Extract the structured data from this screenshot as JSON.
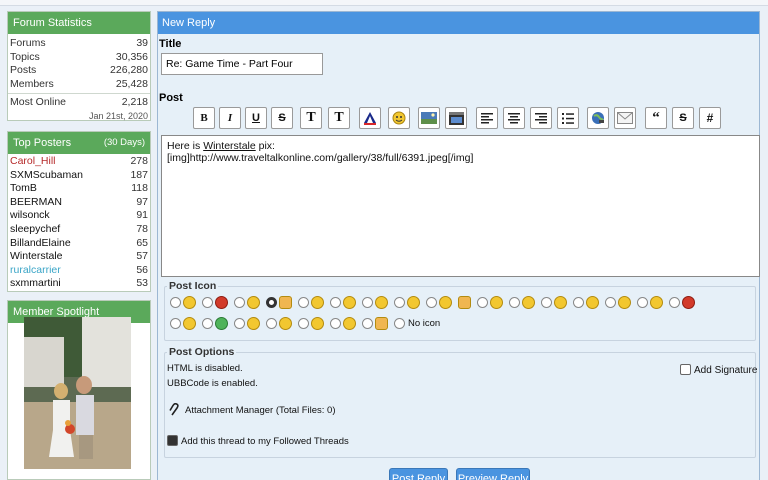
{
  "forum_stats": {
    "title": "Forum Statistics",
    "rows": [
      {
        "label": "Forums",
        "value": "39"
      },
      {
        "label": "Topics",
        "value": "30,356"
      },
      {
        "label": "Posts",
        "value": "226,280"
      },
      {
        "label": "Members",
        "value": "25,428"
      }
    ],
    "most_online": {
      "label": "Most Online",
      "value": "2,218",
      "date": "Jan 21st, 2020"
    }
  },
  "top_posters": {
    "title": "Top Posters",
    "note": "(30 Days)",
    "rows": [
      {
        "name": "Carol_Hill",
        "count": "278",
        "color": "#b52a2a"
      },
      {
        "name": "SXMScubaman",
        "count": "187"
      },
      {
        "name": "TomB",
        "count": "118"
      },
      {
        "name": "BEERMAN",
        "count": "97"
      },
      {
        "name": "wilsonck",
        "count": "91"
      },
      {
        "name": "sleepychef",
        "count": "78"
      },
      {
        "name": "BillandElaine",
        "count": "65"
      },
      {
        "name": "Winterstale",
        "count": "57"
      },
      {
        "name": "ruralcarrier",
        "count": "56",
        "color": "#3aa5c7"
      },
      {
        "name": "sxmmartini",
        "count": "53"
      }
    ]
  },
  "member_spotlight": {
    "title": "Member Spotlight",
    "photo": "member-photo"
  },
  "reply": {
    "header": "New Reply",
    "title_label": "Title",
    "title_value": "Re: Game Time - Part Four",
    "post_label": "Post",
    "toolbar": [
      {
        "name": "bold-button",
        "glyph": "B"
      },
      {
        "name": "italic-button",
        "glyph": "I"
      },
      {
        "name": "underline-button",
        "glyph": "U"
      },
      {
        "name": "strikethrough-button",
        "glyph": "S"
      },
      {
        "name": "font-size-button",
        "glyph": "T"
      },
      {
        "name": "font-face-button",
        "glyph": "T"
      },
      {
        "name": "font-color-icon",
        "glyph": "A"
      },
      {
        "name": "smiley-icon",
        "glyph": ""
      },
      {
        "name": "image-icon",
        "glyph": ""
      },
      {
        "name": "video-icon",
        "glyph": ""
      },
      {
        "name": "align-left-icon",
        "glyph": ""
      },
      {
        "name": "align-center-icon",
        "glyph": ""
      },
      {
        "name": "align-right-icon",
        "glyph": ""
      },
      {
        "name": "list-icon",
        "glyph": ""
      },
      {
        "name": "link-icon",
        "glyph": ""
      },
      {
        "name": "email-icon",
        "glyph": ""
      },
      {
        "name": "quote-icon",
        "glyph": "“"
      },
      {
        "name": "spoiler-icon",
        "glyph": "S"
      },
      {
        "name": "hash-icon",
        "glyph": "#"
      }
    ],
    "body_line1_prefix": "Here is ",
    "body_line1_link": "Winterstale",
    "body_line1_suffix": " pix:",
    "body_line2": "[img]http://www.traveltalkonline.com/gallery/38/full/6391.jpeg[/img]",
    "post_icon_label": "Post Icon",
    "no_icon_label": "No icon",
    "post_options_label": "Post Options",
    "html_status": "HTML is disabled.",
    "ubb_status": "UBBCode is enabled.",
    "add_signature": "Add Signature",
    "attachment_manager": "Attachment Manager (Total Files: 0)",
    "follow_thread": "Add this thread to my Followed Threads",
    "post_reply_button": "Post Reply",
    "preview_reply_button": "Preview Reply"
  },
  "colors": {
    "green_header": "#5ba95b",
    "blue_header": "#4a94e0"
  }
}
